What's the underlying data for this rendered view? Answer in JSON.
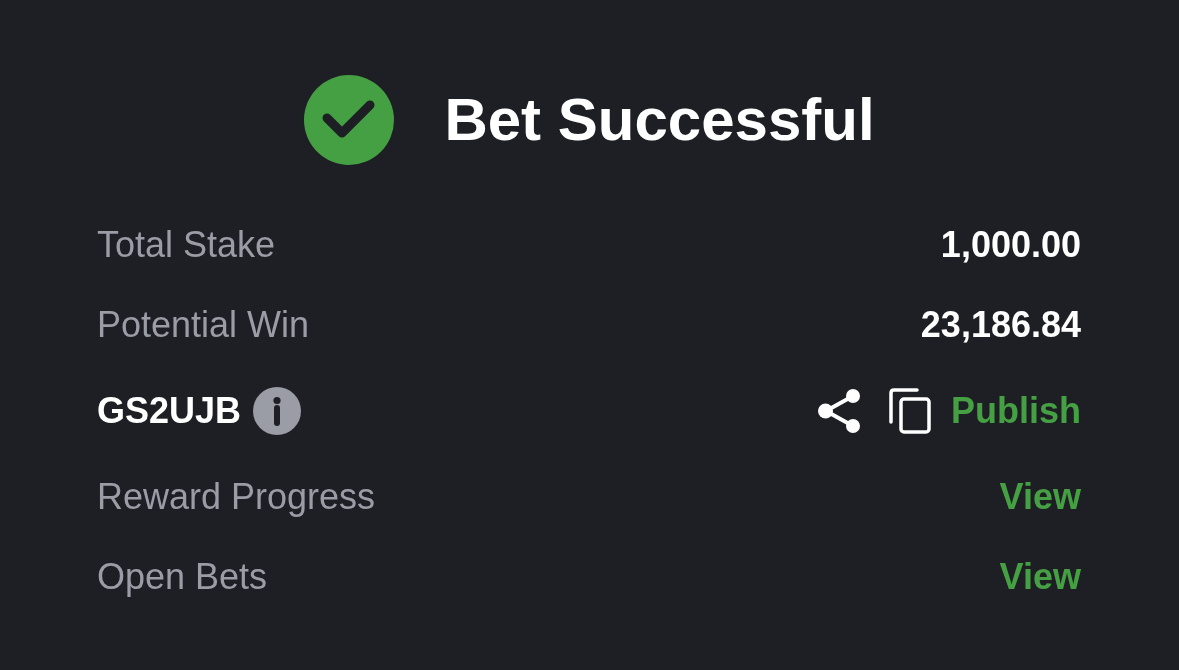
{
  "header": {
    "title": "Bet Successful"
  },
  "rows": [
    {
      "kind": "value",
      "label": "Total Stake",
      "value": "1,000.00"
    },
    {
      "kind": "value",
      "label": "Potential Win",
      "value": "23,186.84"
    },
    {
      "kind": "code",
      "code": "GS2UJB",
      "action": "Publish"
    },
    {
      "kind": "link",
      "label": "Reward Progress",
      "link": "View"
    },
    {
      "kind": "link",
      "label": "Open Bets",
      "link": "View"
    }
  ]
}
